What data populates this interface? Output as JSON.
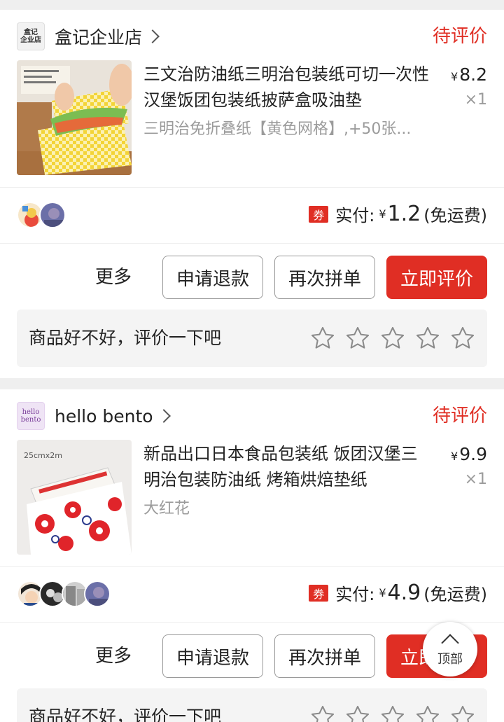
{
  "orders": [
    {
      "shop": {
        "logo_lines": [
          "盒记",
          "企业店"
        ],
        "name": "盒记企业店"
      },
      "status": "待评价",
      "product": {
        "title": "三文治防油纸三明治包装纸可切一次性汉堡饭团包装纸披萨盒吸油垫",
        "spec": "三明治免折叠纸【黄色网格】,+50张...",
        "price_symbol": "¥",
        "price": "8.2",
        "quantity": "×1"
      },
      "payment": {
        "coupon": "券",
        "label": "实付:",
        "symbol": "¥",
        "amount": "1.2",
        "note": "(免运费)"
      },
      "actions": {
        "more": "更多",
        "refund": "申请退款",
        "regroup": "再次拼单",
        "review": "立即评价"
      },
      "rating_prompt": "商品好不好，评价一下吧"
    },
    {
      "shop": {
        "logo_lines": [
          "hello",
          "bento"
        ],
        "name": "hello bento"
      },
      "status": "待评价",
      "product": {
        "title": "新品出口日本食品包装纸 饭团汉堡三明治包装防油纸 烤箱烘焙垫纸",
        "spec": "大红花",
        "price_symbol": "¥",
        "price": "9.9",
        "quantity": "×1",
        "image_text": "25cmx2m"
      },
      "payment": {
        "coupon": "券",
        "label": "实付:",
        "symbol": "¥",
        "amount": "4.9",
        "note": "(免运费)"
      },
      "actions": {
        "more": "更多",
        "refund": "申请退款",
        "regroup": "再次拼单",
        "review": "立即评价"
      },
      "rating_prompt": "商品好不好，评价一下吧"
    }
  ],
  "back_to_top": "顶部",
  "colors": {
    "accent": "#e02e24",
    "muted": "#9b9b9b",
    "background": "#efefef"
  },
  "icons": [
    "chevron-right-icon",
    "star-outline-icon",
    "coupon-icon",
    "arrow-up-icon"
  ]
}
